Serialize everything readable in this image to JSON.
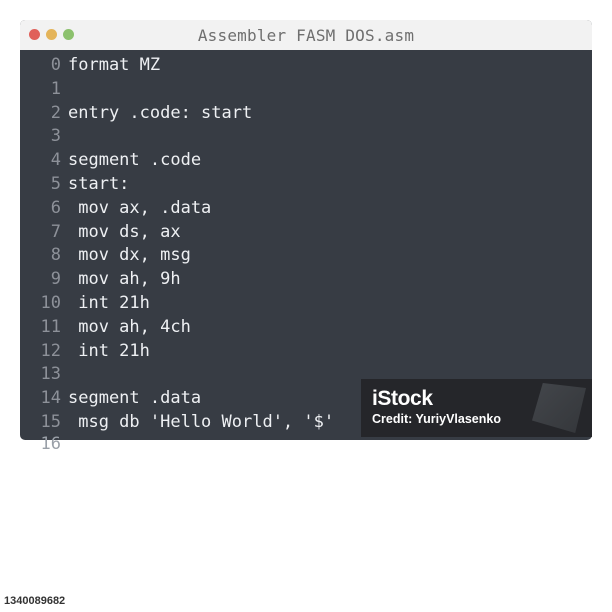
{
  "window": {
    "title": "Assembler FASM DOS.asm",
    "traffic_lights": [
      {
        "name": "close",
        "color": "#e0605a"
      },
      {
        "name": "minimize",
        "color": "#e4b45a"
      },
      {
        "name": "maximize",
        "color": "#8cc16d"
      }
    ]
  },
  "editor": {
    "lines": [
      {
        "num": "0",
        "text": "format MZ"
      },
      {
        "num": "1",
        "text": ""
      },
      {
        "num": "2",
        "text": "entry .code: start"
      },
      {
        "num": "3",
        "text": ""
      },
      {
        "num": "4",
        "text": "segment .code"
      },
      {
        "num": "5",
        "text": "start:"
      },
      {
        "num": "6",
        "text": " mov ax, .data"
      },
      {
        "num": "7",
        "text": " mov ds, ax"
      },
      {
        "num": "8",
        "text": " mov dx, msg"
      },
      {
        "num": "9",
        "text": " mov ah, 9h"
      },
      {
        "num": "10",
        "text": " int 21h"
      },
      {
        "num": "11",
        "text": " mov ah, 4ch"
      },
      {
        "num": "12",
        "text": " int 21h"
      },
      {
        "num": "13",
        "text": ""
      },
      {
        "num": "14",
        "text": "segment .data"
      },
      {
        "num": "15",
        "text": " msg db 'Hello World', '$'"
      }
    ],
    "overflow_line_num": "16"
  },
  "watermark": {
    "logo": "iStock",
    "credit": "Credit: YuriyVlasenko"
  },
  "image_id": "1340089682"
}
